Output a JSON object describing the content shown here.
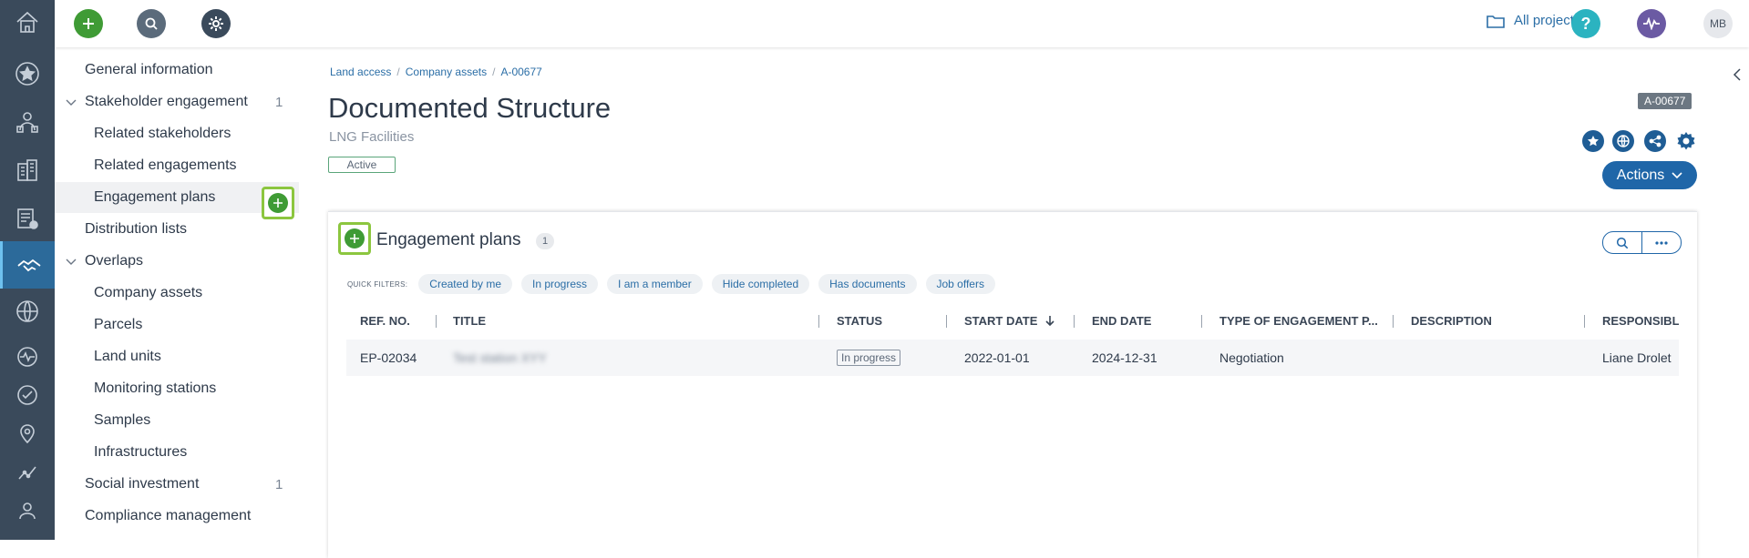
{
  "topbar": {
    "all_projects_label": "All projects",
    "user_initials": "MB",
    "icons": [
      "add-icon",
      "search-icon",
      "gear-icon",
      "folder-icon",
      "help-icon",
      "activity-icon"
    ]
  },
  "rail": {
    "icons": [
      "home-icon",
      "star-icon",
      "people-icon",
      "buildings-icon",
      "checklist-icon",
      "handshake-icon",
      "globe-icon",
      "pulse-icon",
      "check-circle-icon",
      "location-icon",
      "chart-line-icon",
      "user-icon"
    ]
  },
  "nav": {
    "items": [
      {
        "label": "General information"
      },
      {
        "label": "Stakeholder engagement",
        "count": "1"
      },
      {
        "label": "Related stakeholders"
      },
      {
        "label": "Related engagements"
      },
      {
        "label": "Engagement plans"
      },
      {
        "label": "Distribution lists"
      },
      {
        "label": "Overlaps"
      },
      {
        "label": "Company assets"
      },
      {
        "label": "Parcels"
      },
      {
        "label": "Land units"
      },
      {
        "label": "Monitoring stations"
      },
      {
        "label": "Samples"
      },
      {
        "label": "Infrastructures"
      },
      {
        "label": "Social investment",
        "count": "1"
      },
      {
        "label": "Compliance management"
      }
    ]
  },
  "breadcrumb": [
    "Land access",
    "Company assets",
    "A-00677"
  ],
  "page": {
    "title": "Documented Structure",
    "subtitle": "LNG Facilities",
    "status": "Active",
    "id_badge": "A-00677",
    "actions_label": "Actions"
  },
  "panel": {
    "title": "Engagement plans",
    "count": "1",
    "quick_filters_label": "QUICK FILTERS:",
    "quick_filters": [
      "Created by me",
      "In progress",
      "I am a member",
      "Hide completed",
      "Has documents",
      "Job offers"
    ],
    "columns": [
      "REF. NO.",
      "TITLE",
      "STATUS",
      "START DATE",
      "END DATE",
      "TYPE OF ENGAGEMENT P...",
      "DESCRIPTION",
      "RESPONSIBLI"
    ],
    "rows": [
      {
        "ref": "EP-02034",
        "title": "Test station XYY",
        "status": "In progress",
        "start": "2022-01-01",
        "end": "2024-12-31",
        "type": "Negotiation",
        "description": "",
        "responsible": "Liane Drolet"
      }
    ]
  },
  "colors": {
    "rail_bg": "#3a4a5b",
    "accent_blue": "#1f66a8",
    "add_green": "#3f9b35",
    "highlight_green": "#8cc63f"
  }
}
